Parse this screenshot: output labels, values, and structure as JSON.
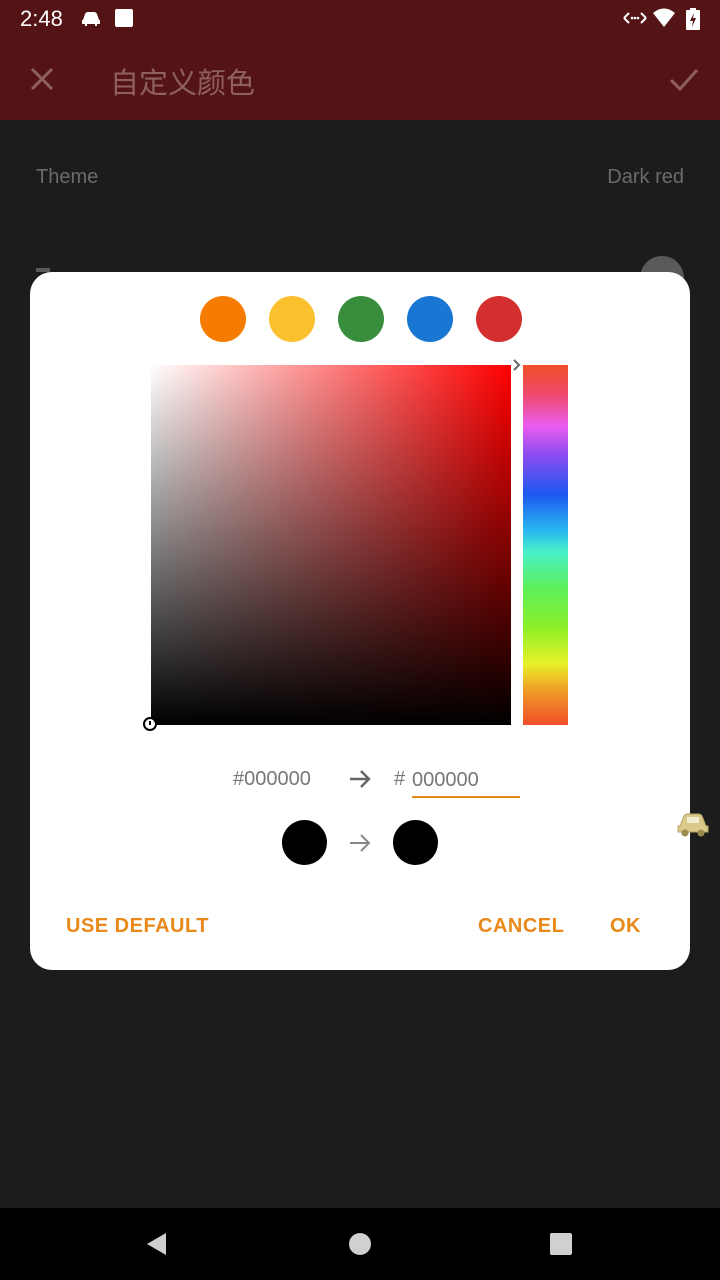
{
  "status_bar": {
    "time": "2:48",
    "icons": [
      "car-icon",
      "square-notification-icon",
      "data-transfer-icon",
      "wifi-icon",
      "battery-icon"
    ]
  },
  "app_bar": {
    "title": "自定义颜色",
    "close_icon": "close-icon",
    "confirm_icon": "check-icon"
  },
  "settings": {
    "theme_label": "Theme",
    "theme_value": "Dark red"
  },
  "dialog": {
    "presets": [
      {
        "name": "orange",
        "color": "#f57c00"
      },
      {
        "name": "yellow",
        "color": "#fbc02d"
      },
      {
        "name": "green",
        "color": "#388e3c"
      },
      {
        "name": "blue",
        "color": "#1976d2"
      },
      {
        "name": "red",
        "color": "#d32f2f"
      }
    ],
    "old_hex": "#000000",
    "hash": "#",
    "new_hex": "000000",
    "old_color": "#000000",
    "new_color": "#000000",
    "buttons": {
      "use_default": "USE DEFAULT",
      "cancel": "CANCEL",
      "ok": "OK"
    },
    "accent_color": "#e8891a"
  },
  "nav_bar": {
    "icons": [
      "back-icon",
      "home-icon",
      "recents-icon"
    ]
  }
}
